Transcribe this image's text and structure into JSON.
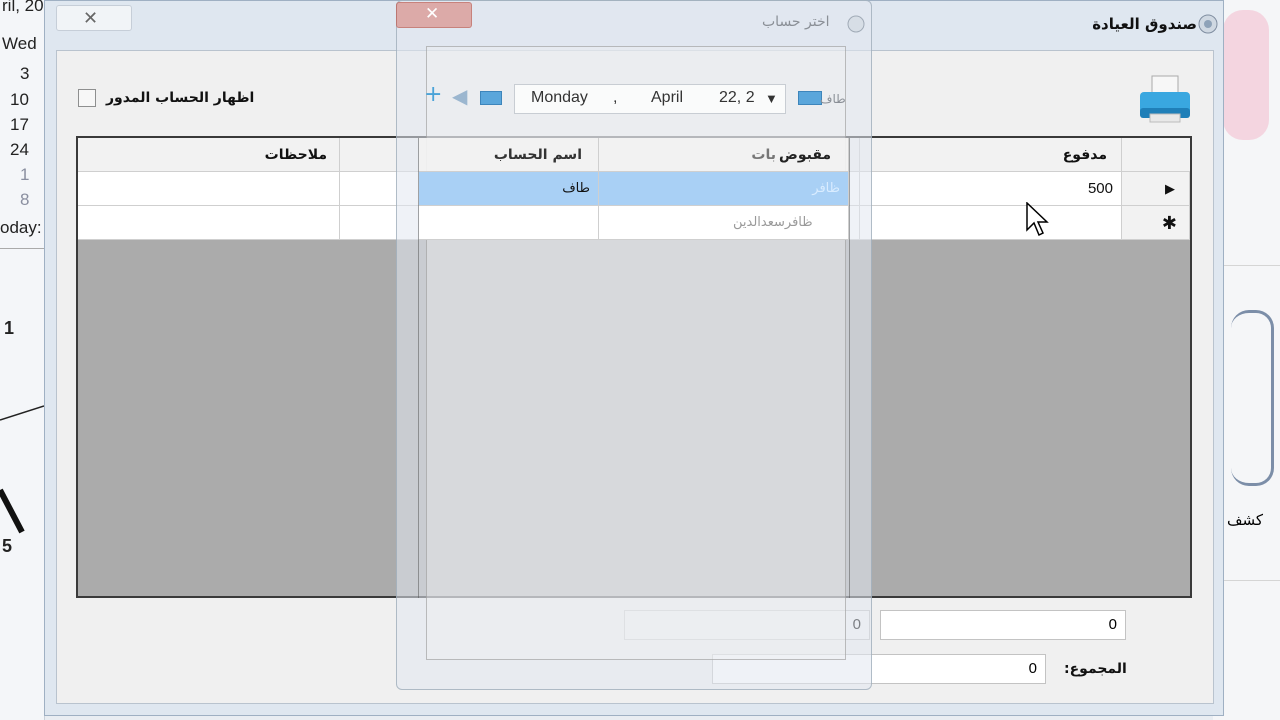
{
  "background": {
    "calendar_lines": [
      "ril, 20",
      "Wed",
      "3",
      "10",
      "17",
      "24",
      "1",
      "8",
      "oday:"
    ],
    "clock_numbers": [
      "1",
      "5"
    ],
    "right_fragment": "كشف"
  },
  "window": {
    "title": "صندوق العيادة",
    "icon": "app-icon"
  },
  "options": {
    "show_rolled_account_label": "اظهار الحساب المدور",
    "show_rolled_account_checked": false
  },
  "grid": {
    "columns": {
      "paid": "مدفوع",
      "received": "مقبوض",
      "notes": "ملاحظات"
    },
    "rows": [
      {
        "marker": "▶",
        "paid": "500",
        "received": "",
        "notes": ""
      },
      {
        "marker": "✱",
        "paid": "",
        "received": "",
        "notes": ""
      }
    ]
  },
  "totals": {
    "paid_total": "0",
    "received_total": "0",
    "sum_label": "المجموع:",
    "sum_value": "0"
  },
  "dialog": {
    "title": "اختر حساب",
    "date": {
      "day": "Monday",
      "sep": ",",
      "month": "April",
      "daynum": "22, 2"
    },
    "search_hint": "طاف",
    "columns": {
      "account_name": "اسم الحساب",
      "accounts": "بات"
    },
    "rows": [
      {
        "account_name": "طاف",
        "account": "ظافر",
        "selected": true
      },
      {
        "account_name": "",
        "account": "ظافرسعدالدين",
        "selected": false
      }
    ]
  }
}
